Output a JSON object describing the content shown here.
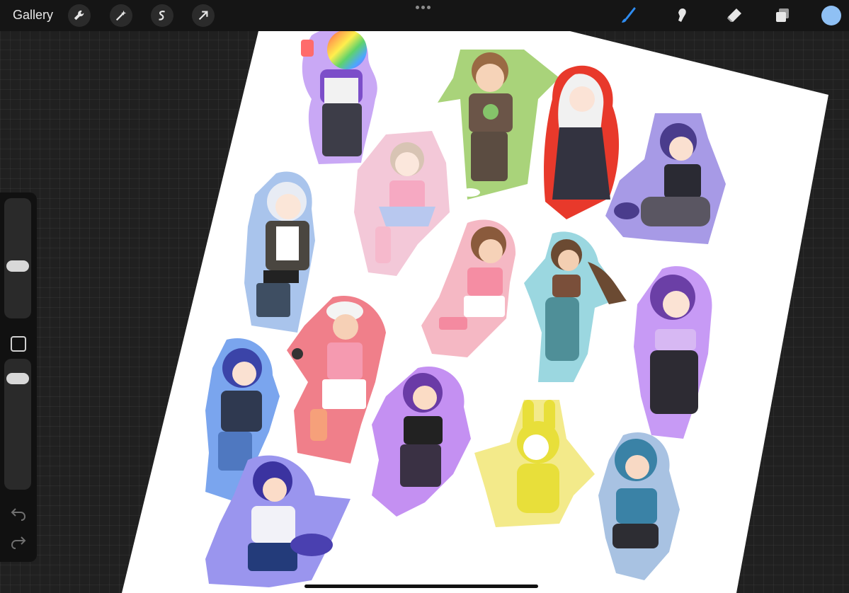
{
  "topbar": {
    "gallery_label": "Gallery",
    "left_tools": [
      {
        "name": "wrench-icon"
      },
      {
        "name": "magic-wand-icon"
      },
      {
        "name": "selection-icon"
      },
      {
        "name": "transform-arrow-icon"
      }
    ],
    "right_tools": [
      {
        "name": "brush-icon",
        "active": true,
        "color": "#2f8cf0"
      },
      {
        "name": "smudge-icon"
      },
      {
        "name": "eraser-icon"
      },
      {
        "name": "layers-icon"
      }
    ],
    "current_color": "#8fc0f4"
  },
  "canvas": {
    "stickers": [
      {
        "name": "sticker-rainbow-head",
        "outline": "#c9a8f5"
      },
      {
        "name": "sticker-bear-frog",
        "outline": "#a9d37a"
      },
      {
        "name": "sticker-red-hood",
        "outline": "#e8392b"
      },
      {
        "name": "sticker-cat-ears",
        "outline": "#a79ae6"
      },
      {
        "name": "sticker-bear-buns",
        "outline": "#f3c8d8"
      },
      {
        "name": "sticker-white-hair",
        "outline": "#a9c4ec"
      },
      {
        "name": "sticker-roller-skates",
        "outline": "#f5b8c4"
      },
      {
        "name": "sticker-teal-pants",
        "outline": "#9bd7e0"
      },
      {
        "name": "sticker-purple-hair",
        "outline": "#c79af5"
      },
      {
        "name": "sticker-golfer",
        "outline": "#f07f8a"
      },
      {
        "name": "sticker-blue-hair-glasses",
        "outline": "#7aa5ee"
      },
      {
        "name": "sticker-skeleton-shirt",
        "outline": "#c490f2"
      },
      {
        "name": "sticker-yellow-bunny",
        "outline": "#f3ea8a"
      },
      {
        "name": "sticker-shark-hoodie",
        "outline": "#a8c2e2"
      },
      {
        "name": "sticker-fox-tail",
        "outline": "#9a95ee"
      }
    ]
  },
  "sidebar": {
    "tools": [
      "brush-size-slider",
      "modify-button",
      "opacity-slider",
      "undo-icon",
      "redo-icon"
    ],
    "brush_size_level": 0.55,
    "opacity_level": 0.85
  }
}
